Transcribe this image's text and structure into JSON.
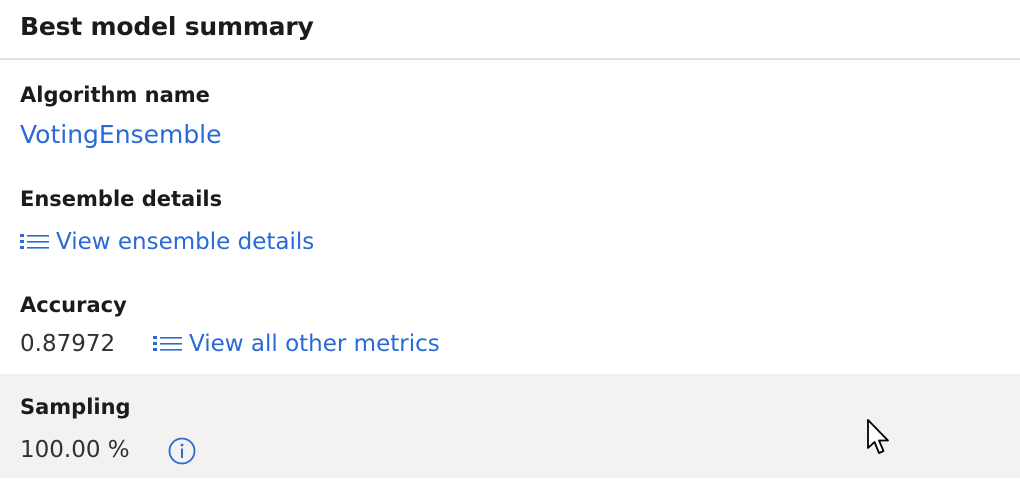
{
  "header": {
    "title": "Best model summary"
  },
  "algorithm": {
    "label": "Algorithm name",
    "value": "VotingEnsemble"
  },
  "ensemble": {
    "label": "Ensemble details",
    "link_label": "View ensemble details",
    "link_icon": "list-icon"
  },
  "accuracy": {
    "label": "Accuracy",
    "value": "0.87972",
    "link_label": "View all other metrics",
    "link_icon": "list-icon"
  },
  "sampling": {
    "label": "Sampling",
    "value": "100.00 %",
    "info_icon": "info-icon"
  },
  "colors": {
    "link": "#2a6ad6",
    "text": "#1b1b1b",
    "highlight_bg": "#f3f2f1",
    "divider": "#e1e1e1"
  }
}
